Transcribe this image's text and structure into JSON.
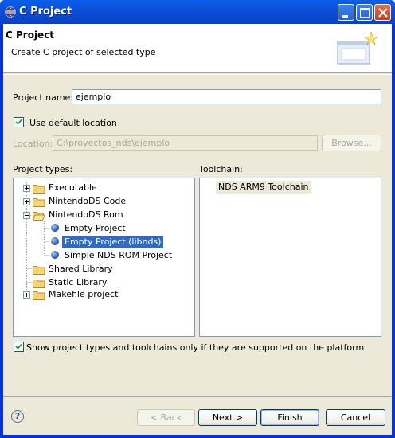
{
  "window": {
    "title": "C Project"
  },
  "header": {
    "title": "C Project",
    "description": "Create C project of selected type"
  },
  "form": {
    "project_name_label": "Project name:",
    "project_name_value": "ejemplo",
    "use_default_location_label": "Use default location",
    "use_default_location_checked": true,
    "location_label": "Location:",
    "location_value": "C:\\proyectos_nds\\ejemplo",
    "browse_label": "Browse..."
  },
  "project_types": {
    "label": "Project types:",
    "items": [
      {
        "label": "Executable",
        "expander": "plus",
        "icon": "folder-icon",
        "selected": false
      },
      {
        "label": "NintendoDS Code",
        "expander": "plus",
        "icon": "folder-icon",
        "selected": false
      },
      {
        "label": "NintendoDS Rom",
        "expander": "minus",
        "icon": "folder-open-icon",
        "selected": false
      },
      {
        "label": "Empty Project",
        "expander": "none",
        "icon": "bullet-icon",
        "selected": false
      },
      {
        "label": "Empty Project (libnds)",
        "expander": "none",
        "icon": "bullet-icon",
        "selected": true
      },
      {
        "label": "Simple NDS ROM Project",
        "expander": "none",
        "icon": "bullet-icon",
        "selected": false
      },
      {
        "label": "Shared Library",
        "expander": "none",
        "icon": "folder-icon",
        "selected": false
      },
      {
        "label": "Static Library",
        "expander": "none",
        "icon": "folder-icon",
        "selected": false
      },
      {
        "label": "Makefile project",
        "expander": "plus",
        "icon": "folder-icon",
        "selected": false
      }
    ]
  },
  "toolchain": {
    "label": "Toolchain:",
    "items": [
      {
        "label": "NDS ARM9 Toolchain",
        "selected": true
      }
    ]
  },
  "filter": {
    "label": "Show project types and toolchains only if they are supported on the platform",
    "checked": true
  },
  "buttons": {
    "help": "?",
    "back": "< Back",
    "next": "Next >",
    "finish": "Finish",
    "cancel": "Cancel"
  },
  "colors": {
    "titlebar": "#0A5FEA",
    "selection": "#316AC5",
    "dialog_bg": "#ECE9D8"
  }
}
